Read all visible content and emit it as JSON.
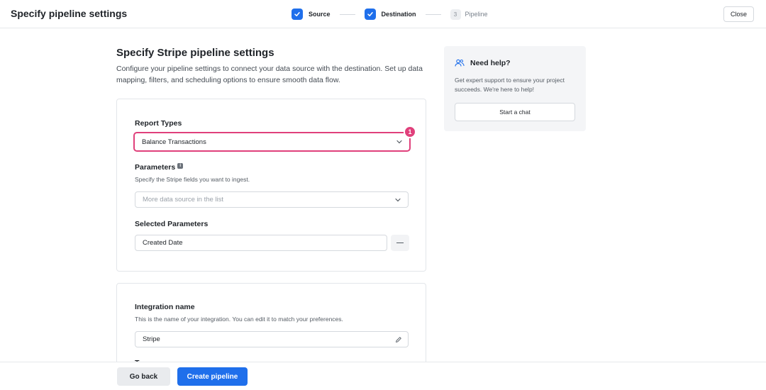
{
  "header": {
    "title": "Specify pipeline settings",
    "steps": [
      {
        "label": "Source",
        "state": "completed"
      },
      {
        "label": "Destination",
        "state": "completed"
      },
      {
        "number": "3",
        "label": "Pipeline",
        "state": "pending"
      }
    ],
    "close_label": "Close"
  },
  "main": {
    "title": "Specify Stripe pipeline settings",
    "description": "Configure your pipeline settings to connect your data source with the destination. Set up data mapping, filters, and scheduling options to ensure smooth data flow.",
    "report_types": {
      "label": "Report Types",
      "selected": "Balance Transactions",
      "annotation_badge": "1"
    },
    "parameters": {
      "label": "Parameters",
      "help": "Specify the Stripe fields you want to ingest.",
      "placeholder": "More data source in the list"
    },
    "selected_parameters": {
      "label": "Selected Parameters",
      "items": [
        "Created Date"
      ]
    },
    "integration": {
      "label": "Integration name",
      "help": "This is the name of your integration. You can edit it to match your preferences.",
      "value": "Stripe"
    },
    "next_section_label_partial": "T..."
  },
  "help_panel": {
    "title": "Need help?",
    "description": "Get expert support to ensure your project succeeds. We're here to help!",
    "button_label": "Start a chat"
  },
  "footer": {
    "back_label": "Go back",
    "create_label": "Create pipeline"
  },
  "colors": {
    "primary": "#1f6feb",
    "highlight": "#e0407b"
  }
}
